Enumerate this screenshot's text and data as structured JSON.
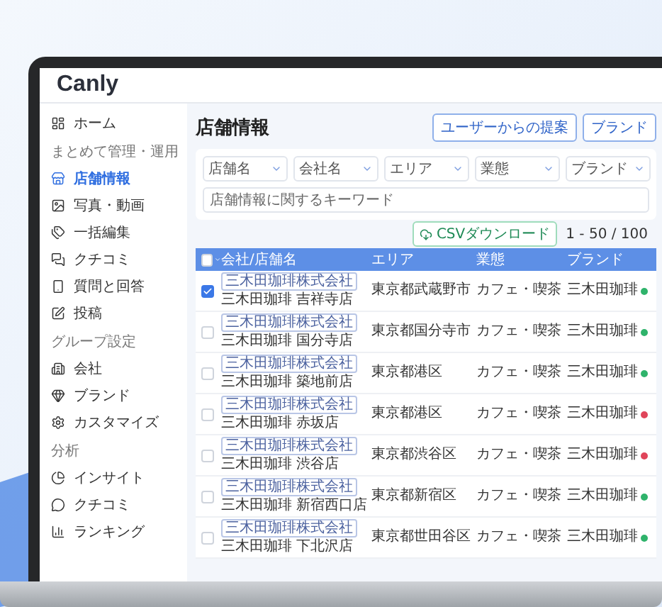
{
  "logo": "Canly",
  "sidebar": {
    "sections": [
      {
        "items": [
          {
            "label": "ホーム",
            "selected": false
          }
        ]
      },
      {
        "title": "まとめて管理・運用",
        "items": [
          {
            "label": "店舗情報",
            "selected": true
          },
          {
            "label": "写真・動画",
            "selected": false
          },
          {
            "label": "一括編集",
            "selected": false
          },
          {
            "label": "クチコミ",
            "selected": false
          },
          {
            "label": "質問と回答",
            "selected": false
          },
          {
            "label": "投稿",
            "selected": false
          }
        ]
      },
      {
        "title": "グループ設定",
        "items": [
          {
            "label": "会社",
            "selected": false
          },
          {
            "label": "ブランド",
            "selected": false
          },
          {
            "label": "カスタマイズ",
            "selected": false
          }
        ]
      },
      {
        "title": "分析",
        "items": [
          {
            "label": "インサイト",
            "selected": false
          },
          {
            "label": "クチコミ",
            "selected": false
          },
          {
            "label": "ランキング",
            "selected": false
          }
        ]
      }
    ]
  },
  "page_title": "店舗情報",
  "header_buttons": [
    "ユーザーからの提案",
    "ブランド"
  ],
  "filters": [
    "店舗名",
    "会社名",
    "エリア",
    "業態",
    "ブランド"
  ],
  "search": {
    "placeholder": "店舗情報に関するキーワード"
  },
  "csv_button": "CSVダウンロード",
  "pagination": "1 - 50 / 100",
  "table": {
    "select_all": {
      "checked": false
    },
    "columns": [
      "会社/店舗名",
      "エリア",
      "業態",
      "ブランド"
    ],
    "rows": [
      {
        "checked": true,
        "company": "三木田珈琲株式会社",
        "store": "三木田珈琲 吉祥寺店",
        "area": "東京都武蔵野市",
        "category": "カフェ・喫茶",
        "brand": "三木田珈琲",
        "color": "#2fb36b"
      },
      {
        "checked": false,
        "company": "三木田珈琲株式会社",
        "store": "三木田珈琲 国分寺店",
        "area": "東京都国分寺市",
        "category": "カフェ・喫茶",
        "brand": "三木田珈琲",
        "color": "#2fb36b"
      },
      {
        "checked": false,
        "company": "三木田珈琲株式会社",
        "store": "三木田珈琲 築地前店",
        "area": "東京都港区",
        "category": "カフェ・喫茶",
        "brand": "三木田珈琲",
        "color": "#2fb36b"
      },
      {
        "checked": false,
        "company": "三木田珈琲株式会社",
        "store": "三木田珈琲 赤坂店",
        "area": "東京都港区",
        "category": "カフェ・喫茶",
        "brand": "三木田珈琲",
        "color": "#e0455a"
      },
      {
        "checked": false,
        "company": "三木田珈琲株式会社",
        "store": "三木田珈琲 渋谷店",
        "area": "東京都渋谷区",
        "category": "カフェ・喫茶",
        "brand": "三木田珈琲",
        "color": "#e0455a"
      },
      {
        "checked": false,
        "company": "三木田珈琲株式会社",
        "store": "三木田珈琲 新宿西口店",
        "area": "東京都新宿区",
        "category": "カフェ・喫茶",
        "brand": "三木田珈琲",
        "color": "#2fb36b"
      },
      {
        "checked": false,
        "company": "三木田珈琲株式会社",
        "store": "三木田珈琲 下北沢店",
        "area": "東京都世田谷区",
        "category": "カフェ・喫茶",
        "brand": "三木田珈琲",
        "color": "#2fb36b"
      }
    ]
  }
}
